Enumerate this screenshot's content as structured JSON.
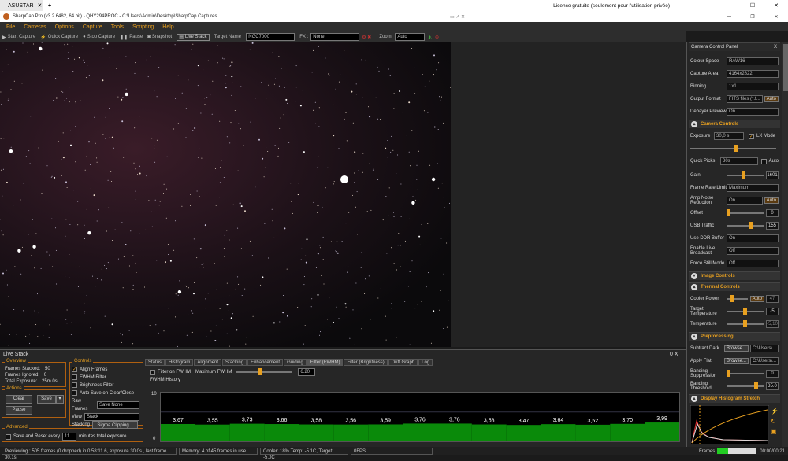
{
  "window": {
    "tab_label": "ASUSTAR",
    "new_tab": "+",
    "license": "Licence gratuite (seulement pour l'utilisation privée)"
  },
  "app": {
    "title": "SharpCap Pro (v3.2.6482, 64 bit) - QHY294PROC - C:\\Users\\Admin\\Desktop\\SharpCap Captures"
  },
  "menu": [
    "File",
    "Cameras",
    "Options",
    "Capture",
    "Tools",
    "Scripting",
    "Help"
  ],
  "toolbar": {
    "start_capture": "Start Capture",
    "quick_capture": "Quick Capture",
    "stop_capture": "Stop Capture",
    "pause": "Pause",
    "snapshot": "Snapshot",
    "live_stack": "Live Stack",
    "target_label": "Target Name :",
    "target_value": "NGC7000",
    "fx_label": "FX :",
    "fx_value": "None",
    "zoom_label": "Zoom:",
    "zoom_value": "Auto"
  },
  "live_stack": {
    "title": "Live Stack",
    "close": "0 X",
    "overview_title": "Overview",
    "frames_stacked_label": "Frames Stacked:",
    "frames_stacked": "50",
    "frames_ignored_label": "Frames Ignored:",
    "frames_ignored": "0",
    "total_exposure_label": "Total Exposure:",
    "total_exposure": "25m 0s",
    "actions_title": "Actions",
    "clear": "Clear",
    "save": "Save",
    "pause": "Pause",
    "advanced_title": "Advanced",
    "save_reset_label": "Save and Reset every",
    "save_reset_value": "11",
    "save_reset_suffix": "minutes total exposure",
    "controls_title": "Controls",
    "align_frames": "Align Frames",
    "fwhm_filter": "FWHM Filter",
    "brightness_filter": "Brightness Filter",
    "auto_save": "Auto Save on Clear/Close",
    "raw_frames_label": "Raw Frames",
    "raw_frames_value": "Save None",
    "view_label": "View",
    "view_value": "Stack",
    "stacking_label": "Stacking",
    "stacking_value": "Sigma Clipping...",
    "tabs": [
      "Status",
      "Histogram",
      "Alignment",
      "Stacking",
      "Enhancement",
      "Guiding",
      "Filter (FWHM)",
      "Filter (Brightness)",
      "Drift Graph",
      "Log"
    ],
    "filter_on_fwhm": "Filter on FWHM",
    "max_fwhm_label": "Maximum FWHM",
    "max_fwhm_value": "6.20",
    "fwhm_history": "FWHM History",
    "axis_10": "10",
    "axis_0": "0",
    "fwhm_values": [
      "3,67",
      "3,55",
      "3,73",
      "3,66",
      "3,58",
      "3,56",
      "3,59",
      "3,76",
      "3,76",
      "3,58",
      "3,47",
      "3,64",
      "3,52",
      "3,70",
      "3,99"
    ]
  },
  "status": {
    "previewing": "Previewing : 505 frames (0 dropped) in 0:58:11.6, exposure 30.0s , last frame 30.1s",
    "memory": "Memory: 4 of 45 frames in use.",
    "cooler": "Cooler: 18%  Temp: -5.1C, Target: -5.0C",
    "fps": "0FPS",
    "frames_label": "Frames",
    "time": "00:00/00:21"
  },
  "panel": {
    "title": "Camera Control Panel",
    "close": "X",
    "colour_space_label": "Colour Space",
    "colour_space": "RAW16",
    "capture_area_label": "Capture Area",
    "capture_area": "4164x2822",
    "binning_label": "Binning",
    "binning": "1x1",
    "output_format_label": "Output Format",
    "output_format": "FITS files (*.f...",
    "output_auto": "Auto",
    "debayer_label": "Debayer Preview",
    "debayer": "On",
    "camera_controls": "Camera Controls",
    "exposure_label": "Exposure",
    "exposure": "30,0 s",
    "lx_mode": "LX Mode",
    "quick_picks_label": "Quick Picks",
    "quick_picks": "30s",
    "quick_auto": "Auto",
    "gain_label": "Gain",
    "gain": "1601",
    "frame_rate_label": "Frame Rate Limit",
    "frame_rate": "Maximum",
    "amp_noise_label": "Amp Noise Reduction",
    "amp_noise": "On",
    "amp_auto": "Auto",
    "offset_label": "Offset",
    "offset": "0",
    "usb_label": "USB Traffic",
    "usb": "155",
    "ddr_label": "Use DDR Buffer",
    "ddr": "On",
    "broadcast_label": "Enable Live Broadcast",
    "broadcast": "Off",
    "still_mode_label": "Force Still Mode",
    "still_mode": "Off",
    "image_controls": "Image Controls",
    "thermal_controls": "Thermal Controls",
    "cooler_power_label": "Cooler Power",
    "cooler_auto": "Auto",
    "cooler_power": "47",
    "target_temp_label": "Target Temperature",
    "target_temp": "-5",
    "temperature_label": "Temperature",
    "temperature": "-5,10",
    "preprocessing": "Preprocessing",
    "subtract_dark_label": "Subtract Dark",
    "browse": "Browse...",
    "dark_path": "C:\\Users\\...",
    "apply_flat_label": "Apply Flat",
    "flat_path": "C:\\Users\\...",
    "banding_supp_label": "Banding Suppression",
    "banding_supp": "0",
    "banding_thresh_label": "Banding Threshold",
    "banding_thresh": "35.0",
    "histogram": "Display Histogram Stretch"
  },
  "colors": {
    "accent": "#e8a020",
    "bar": "#0a8a0a"
  }
}
